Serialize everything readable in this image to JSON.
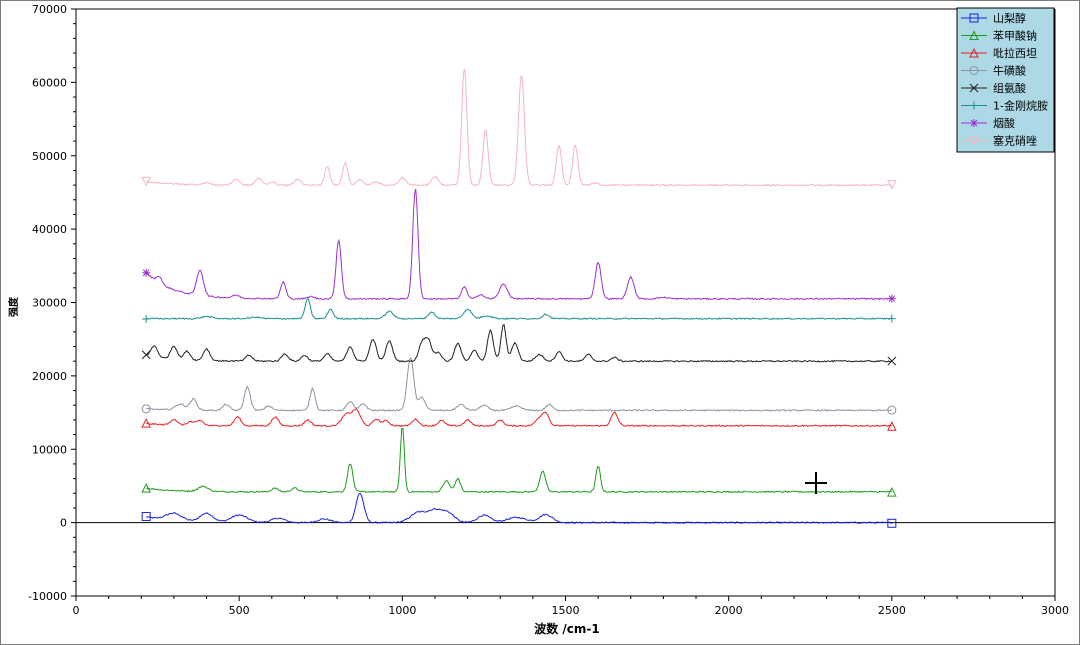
{
  "chart_data": {
    "type": "line",
    "title": "",
    "xlabel": "波数 /cm-1",
    "ylabel": "强度",
    "xlim": [
      0,
      3000
    ],
    "ylim": [
      -10000,
      70000
    ],
    "xticks": [
      0,
      500,
      1000,
      1500,
      2000,
      2500,
      3000
    ],
    "yticks": [
      -10000,
      0,
      10000,
      20000,
      30000,
      40000,
      50000,
      60000,
      70000
    ],
    "grid": false,
    "legend_position": "top-right",
    "x_range": [
      215,
      2500
    ],
    "series": [
      {
        "name": "山梨醇",
        "color": "#1a22e0",
        "marker": "square",
        "baseline": 0,
        "start_offset": 800,
        "end_offset": 0,
        "peaks": [
          [
            300,
            1000,
            25
          ],
          [
            400,
            1200,
            20
          ],
          [
            500,
            1000,
            25
          ],
          [
            620,
            600,
            20
          ],
          [
            760,
            500,
            20
          ],
          [
            870,
            4000,
            12
          ],
          [
            1050,
            1400,
            25
          ],
          [
            1100,
            1500,
            20
          ],
          [
            1140,
            1300,
            20
          ],
          [
            1250,
            1000,
            20
          ],
          [
            1350,
            700,
            30
          ],
          [
            1440,
            1100,
            20
          ]
        ]
      },
      {
        "name": "苯甲酸钠",
        "color": "#1e9a1e",
        "marker": "triangle",
        "baseline": 4200,
        "start_offset": 500,
        "end_offset": 0,
        "peaks": [
          [
            390,
            700,
            15
          ],
          [
            610,
            500,
            10
          ],
          [
            670,
            500,
            10
          ],
          [
            840,
            3900,
            8
          ],
          [
            1000,
            9000,
            6
          ],
          [
            1135,
            1500,
            10
          ],
          [
            1170,
            1800,
            8
          ],
          [
            1430,
            2800,
            9
          ],
          [
            1600,
            3500,
            7
          ]
        ]
      },
      {
        "name": "吡拉西坦",
        "color": "#e82020",
        "marker": "triangle",
        "baseline": 13200,
        "start_offset": 300,
        "end_offset": 0,
        "peaks": [
          [
            300,
            800,
            10
          ],
          [
            350,
            500,
            10
          ],
          [
            380,
            700,
            10
          ],
          [
            495,
            1200,
            10
          ],
          [
            610,
            1200,
            10
          ],
          [
            710,
            800,
            10
          ],
          [
            830,
            1600,
            15
          ],
          [
            860,
            2000,
            12
          ],
          [
            920,
            900,
            10
          ],
          [
            950,
            700,
            10
          ],
          [
            1040,
            900,
            10
          ],
          [
            1120,
            700,
            10
          ],
          [
            1200,
            800,
            10
          ],
          [
            1300,
            800,
            10
          ],
          [
            1420,
            1000,
            12
          ],
          [
            1440,
            1600,
            10
          ],
          [
            1650,
            1800,
            10
          ]
        ]
      },
      {
        "name": "牛磺酸",
        "color": "#8c94a0",
        "marker": "circle",
        "baseline": 15300,
        "start_offset": 200,
        "end_offset": 0,
        "peaks": [
          [
            320,
            800,
            15
          ],
          [
            360,
            1500,
            10
          ],
          [
            460,
            800,
            10
          ],
          [
            525,
            3200,
            9
          ],
          [
            590,
            600,
            10
          ],
          [
            725,
            3000,
            8
          ],
          [
            840,
            1200,
            10
          ],
          [
            880,
            900,
            10
          ],
          [
            1025,
            7200,
            10
          ],
          [
            1060,
            1800,
            10
          ],
          [
            1180,
            800,
            12
          ],
          [
            1250,
            700,
            12
          ],
          [
            1350,
            600,
            15
          ],
          [
            1450,
            800,
            10
          ]
        ]
      },
      {
        "name": "组氨酸",
        "color": "#202020",
        "marker": "x",
        "baseline": 22000,
        "start_offset": 800,
        "end_offset": 0,
        "peaks": [
          [
            240,
            1500,
            10
          ],
          [
            300,
            1800,
            10
          ],
          [
            340,
            1200,
            10
          ],
          [
            400,
            1600,
            10
          ],
          [
            530,
            800,
            10
          ],
          [
            640,
            1000,
            10
          ],
          [
            700,
            800,
            10
          ],
          [
            770,
            1000,
            10
          ],
          [
            840,
            2000,
            10
          ],
          [
            910,
            3000,
            10
          ],
          [
            960,
            2800,
            10
          ],
          [
            1060,
            2400,
            10
          ],
          [
            1080,
            2800,
            10
          ],
          [
            1110,
            1200,
            10
          ],
          [
            1170,
            2400,
            10
          ],
          [
            1220,
            1500,
            10
          ],
          [
            1270,
            4200,
            9
          ],
          [
            1310,
            5000,
            8
          ],
          [
            1345,
            2500,
            10
          ],
          [
            1420,
            900,
            12
          ],
          [
            1480,
            1300,
            10
          ],
          [
            1570,
            900,
            10
          ],
          [
            1650,
            500,
            10
          ]
        ]
      },
      {
        "name": "1-金刚烷胺",
        "color": "#1a9090",
        "marker": "plus",
        "baseline": 27800,
        "start_offset": 0,
        "end_offset": 0,
        "peaks": [
          [
            400,
            300,
            15
          ],
          [
            550,
            200,
            15
          ],
          [
            710,
            2700,
            8
          ],
          [
            780,
            1300,
            8
          ],
          [
            960,
            1000,
            12
          ],
          [
            1090,
            900,
            10
          ],
          [
            1200,
            1300,
            12
          ],
          [
            1260,
            400,
            15
          ],
          [
            1440,
            600,
            10
          ]
        ]
      },
      {
        "name": "烟酸",
        "color": "#9a30d0",
        "marker": "asterisk",
        "baseline": 30500,
        "start_offset": 3600,
        "end_offset": 0,
        "peaks": [
          [
            255,
            900,
            8
          ],
          [
            380,
            3500,
            10
          ],
          [
            490,
            400,
            10
          ],
          [
            635,
            2300,
            8
          ],
          [
            720,
            300,
            10
          ],
          [
            805,
            8000,
            8
          ],
          [
            1040,
            15000,
            8
          ],
          [
            1190,
            1700,
            8
          ],
          [
            1240,
            600,
            10
          ],
          [
            1310,
            2000,
            12
          ],
          [
            1600,
            5000,
            9
          ],
          [
            1700,
            3000,
            10
          ],
          [
            1800,
            200,
            15
          ]
        ]
      },
      {
        "name": "塞克硝唑",
        "color": "#f5b4c0",
        "marker": "triangle-down",
        "baseline": 46000,
        "start_offset": 500,
        "end_offset": 0,
        "peaks": [
          [
            400,
            300,
            10
          ],
          [
            490,
            800,
            10
          ],
          [
            560,
            900,
            10
          ],
          [
            600,
            400,
            10
          ],
          [
            680,
            800,
            10
          ],
          [
            770,
            2500,
            8
          ],
          [
            825,
            3000,
            8
          ],
          [
            870,
            700,
            10
          ],
          [
            920,
            500,
            10
          ],
          [
            1000,
            1000,
            10
          ],
          [
            1100,
            1200,
            10
          ],
          [
            1190,
            16000,
            8
          ],
          [
            1255,
            7500,
            8
          ],
          [
            1365,
            15000,
            9
          ],
          [
            1480,
            5500,
            8
          ],
          [
            1530,
            5500,
            8
          ],
          [
            1590,
            300,
            10
          ]
        ]
      }
    ],
    "legend": [
      "山梨醇",
      "苯甲酸钠",
      "吡拉西坦",
      "牛磺酸",
      "组氨酸",
      "1-金刚烷胺",
      "烟酸",
      "塞克硝唑"
    ]
  }
}
